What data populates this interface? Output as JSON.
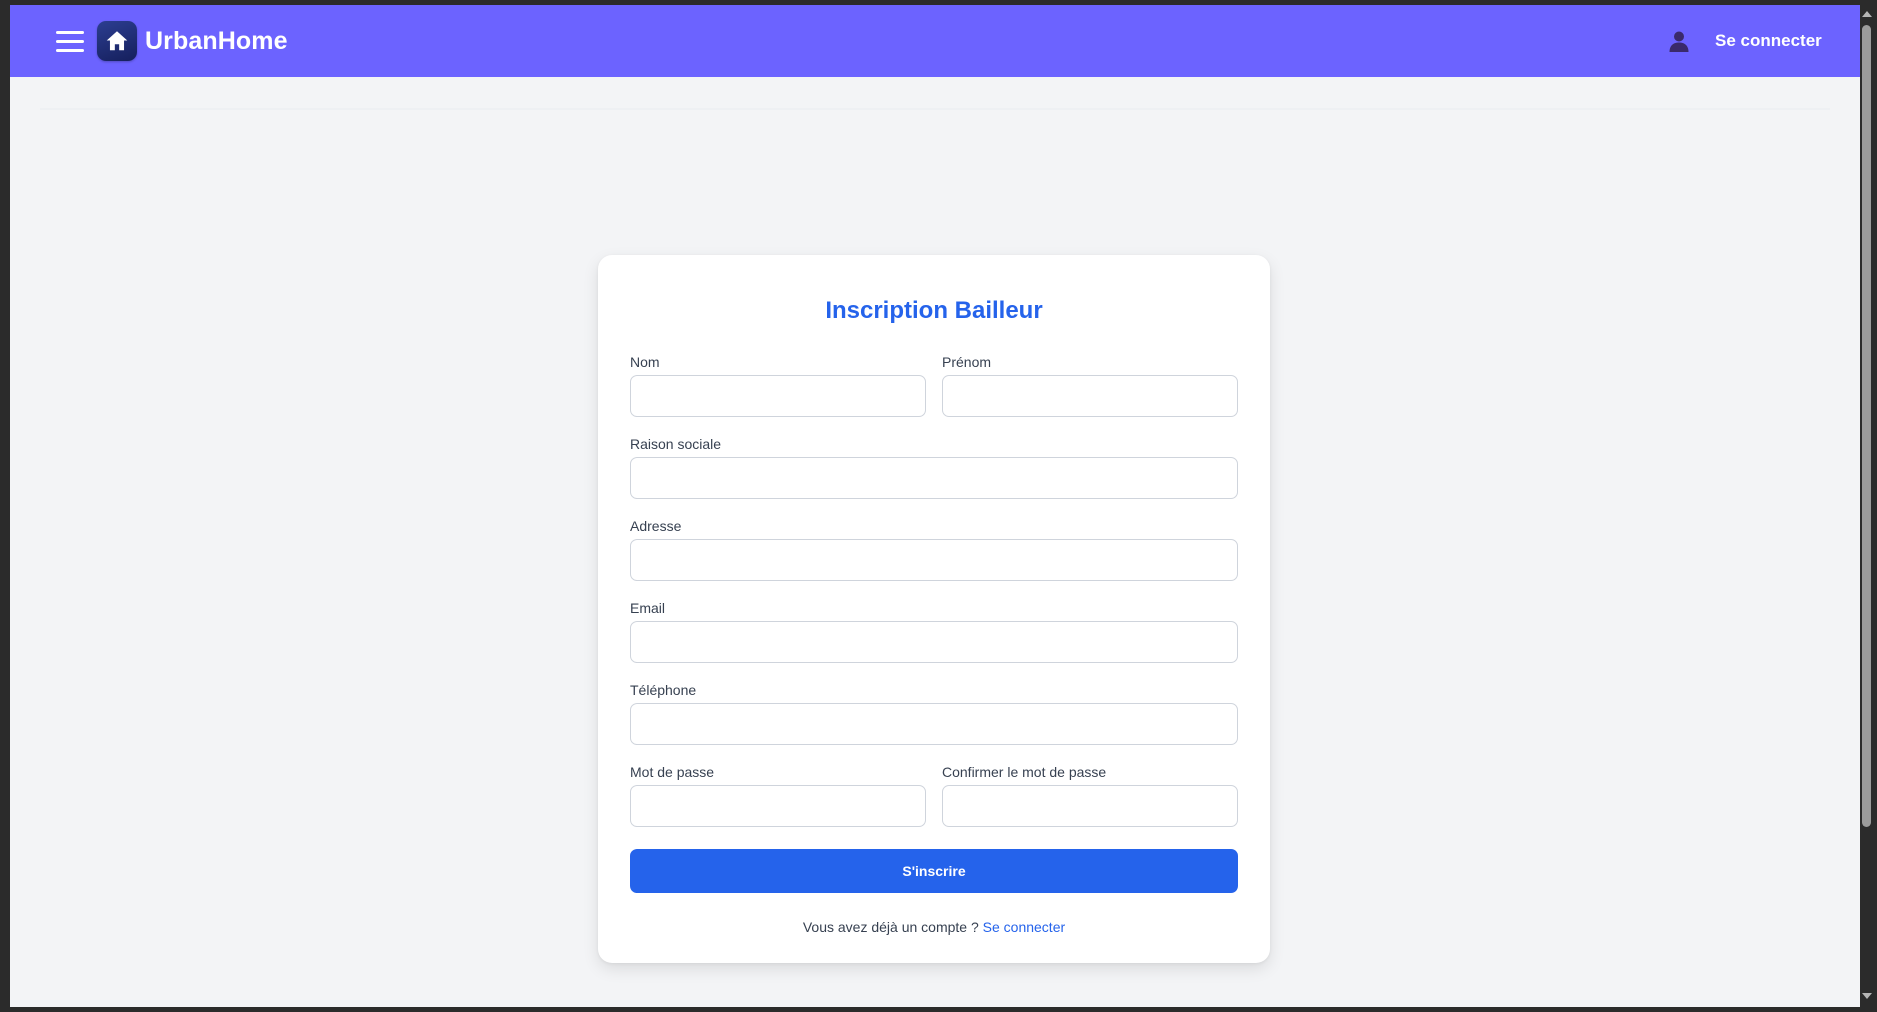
{
  "app": {
    "brand": "UrbanHome",
    "colors": {
      "navbar": "#6c63ff",
      "accent": "#2563eb",
      "background": "#f3f4f6",
      "logo_badge": "#1e2a78"
    }
  },
  "navbar": {
    "menu_icon": "hamburger-menu-icon",
    "logo_icon": "home-icon",
    "user_icon": "user-icon",
    "login_label": "Se connecter"
  },
  "form": {
    "title": "Inscription Bailleur",
    "fields": {
      "nom": {
        "label": "Nom",
        "value": ""
      },
      "prenom": {
        "label": "Prénom",
        "value": ""
      },
      "raison_sociale": {
        "label": "Raison sociale",
        "value": ""
      },
      "adresse": {
        "label": "Adresse",
        "value": ""
      },
      "email": {
        "label": "Email",
        "value": ""
      },
      "telephone": {
        "label": "Téléphone",
        "value": ""
      },
      "mot_de_passe": {
        "label": "Mot de passe",
        "value": ""
      },
      "confirmer": {
        "label": "Confirmer le mot de passe",
        "value": ""
      }
    },
    "submit_label": "S'inscrire",
    "footer_text": "Vous avez déjà un compte ? ",
    "footer_link": "Se connecter"
  }
}
